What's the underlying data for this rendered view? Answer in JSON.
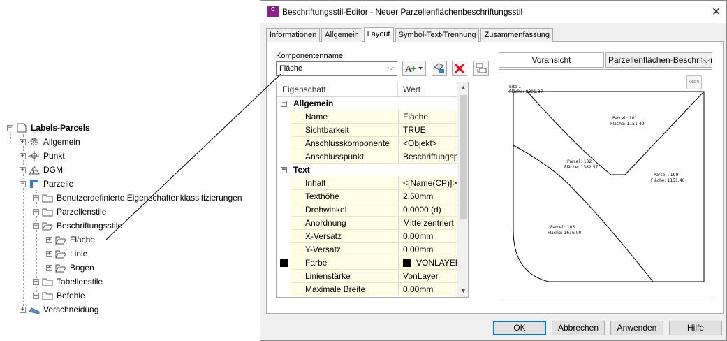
{
  "tree": {
    "root": "Labels-Parcels",
    "items": [
      {
        "label": "Allgemein",
        "icon": "gear-icon"
      },
      {
        "label": "Punkt",
        "icon": "point-icon"
      },
      {
        "label": "DGM",
        "icon": "surface-icon"
      },
      {
        "label": "Parzelle",
        "icon": "parcel-icon"
      },
      {
        "label": "Benutzerdefinierte Eigenschaftenklassifizierungen",
        "icon": "folder-icon"
      },
      {
        "label": "Parzellenstile",
        "icon": "folder-icon"
      },
      {
        "label": "Beschriftungsstile",
        "icon": "folder-icon"
      },
      {
        "label": "Fläche",
        "icon": "folder-icon"
      },
      {
        "label": "Linie",
        "icon": "folder-icon"
      },
      {
        "label": "Bogen",
        "icon": "folder-icon"
      },
      {
        "label": "Tabellenstile",
        "icon": "folder-icon"
      },
      {
        "label": "Befehle",
        "icon": "folder-icon"
      },
      {
        "label": "Verschneidung",
        "icon": "grading-icon"
      }
    ]
  },
  "dialog": {
    "title": "Beschriftungsstil-Editor - Neuer Parzellenflächenbeschriftungsstil",
    "app_icon_text": "C",
    "tabs": [
      "Informationen",
      "Allgemein",
      "Layout",
      "Symbol-Text-Trennung",
      "Zusammenfassung"
    ],
    "active_tab": "Layout",
    "component_label": "Komponentenname:",
    "component_value": "Fläche",
    "grid": {
      "col1": "Eigenschaft",
      "col2": "Wert",
      "rows": [
        {
          "type": "cat",
          "name": "Allgemein"
        },
        {
          "type": "prop",
          "name": "Name",
          "value": "Fläche"
        },
        {
          "type": "prop",
          "name": "Sichtbarkeit",
          "value": "TRUE"
        },
        {
          "type": "prop",
          "name": "Anschlusskomponente",
          "value": "<Objekt>"
        },
        {
          "type": "prop",
          "name": "Anschlusspunkt",
          "value": "Beschriftungspos..."
        },
        {
          "type": "cat",
          "name": "Text"
        },
        {
          "type": "prop",
          "name": "Inhalt",
          "value": "<[Name(CP)]>\\..."
        },
        {
          "type": "prop",
          "name": "Texthöhe",
          "value": "2.50mm"
        },
        {
          "type": "prop",
          "name": "Drehwinkel",
          "value": "0.0000 (d)"
        },
        {
          "type": "prop",
          "name": "Anordnung",
          "value": "Mitte zentriert"
        },
        {
          "type": "prop",
          "name": "X-Versatz",
          "value": "0.00mm"
        },
        {
          "type": "prop",
          "name": "Y-Versatz",
          "value": "0.00mm"
        },
        {
          "type": "prop",
          "name": "Farbe",
          "value": "VONLAYER",
          "swatch": true
        },
        {
          "type": "prop",
          "name": "Linienstärke",
          "value": "VonLayer"
        },
        {
          "type": "prop",
          "name": "Maximale Breite",
          "value": "0.00mm"
        }
      ]
    },
    "preview": {
      "button": "Voransicht",
      "select": "Parzellenflächen-Beschriftung",
      "oben": "OBEN",
      "labels": [
        {
          "name": "Site 1",
          "area": "Fläche: 8301.37"
        },
        {
          "name": "Parcel : 101",
          "area": "Fläche: 1151.40"
        },
        {
          "name": "Parcel : 102",
          "area": "Fläche: 1382.57"
        },
        {
          "name": "Parcel : 100",
          "area": "Fläche: 1151.40"
        },
        {
          "name": "Parcel : 103",
          "area": "Fläche: 1616.00"
        }
      ]
    },
    "buttons": {
      "ok": "OK",
      "cancel": "Abbrechen",
      "apply": "Anwenden",
      "help": "Hilfe"
    },
    "colors": {
      "accent": "#0078d7",
      "delete": "#e81123",
      "grid_bg": "#fffde6"
    }
  }
}
